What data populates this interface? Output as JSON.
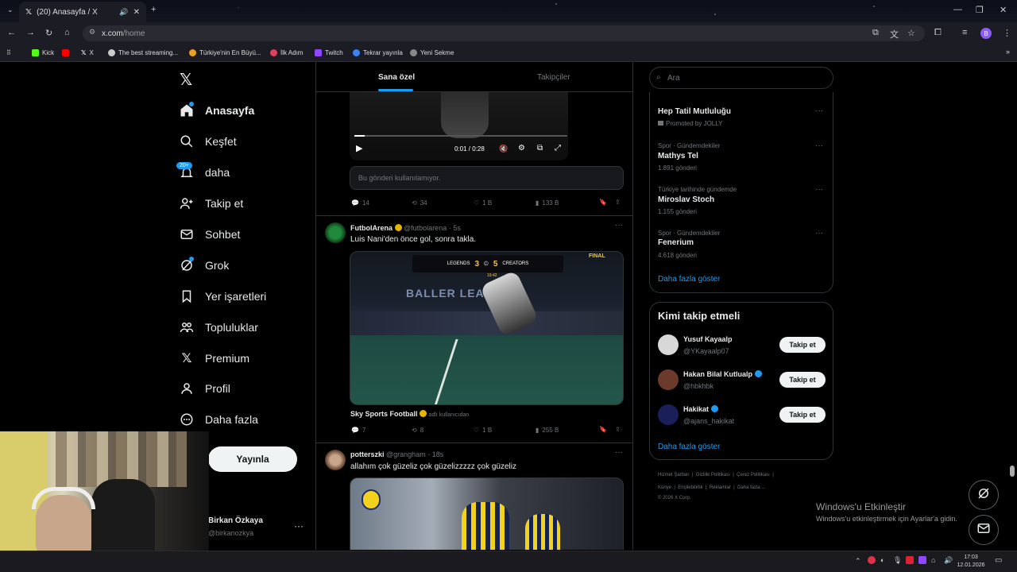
{
  "browser": {
    "tab_title": "(20) Anasayfa / X",
    "url_prefix": "x.com",
    "url_path": "/home",
    "profile_initial": "B",
    "bookmarks": [
      {
        "label": "Kick",
        "color": "#53fc18"
      },
      {
        "label": "",
        "color": "#ff0000"
      },
      {
        "label": "X",
        "color": "#ffffff"
      },
      {
        "label": "The best streaming...",
        "color": "#cccccc"
      },
      {
        "label": "Türkiye'nin En Büyü...",
        "color": "#f0a020"
      },
      {
        "label": "İlk Adım",
        "color": "#e04060"
      },
      {
        "label": "Twitch",
        "color": "#9146ff"
      },
      {
        "label": "Tekrar yayınla",
        "color": "#3b82f6"
      },
      {
        "label": "Yeni Sekme",
        "color": "#888888"
      }
    ]
  },
  "nav": {
    "items": [
      {
        "label": "Anasayfa",
        "icon": "home-icon"
      },
      {
        "label": "Keşfet",
        "icon": "search-icon"
      },
      {
        "label": "daha",
        "icon": "bell-icon",
        "badge": "20+"
      },
      {
        "label": "Takip et",
        "icon": "add-user-icon"
      },
      {
        "label": "Sohbet",
        "icon": "mail-icon"
      },
      {
        "label": "Grok",
        "icon": "grok-icon"
      },
      {
        "label": "Yer işaretleri",
        "icon": "bookmark-icon"
      },
      {
        "label": "Topluluklar",
        "icon": "communities-icon"
      },
      {
        "label": "Premium",
        "icon": "x-logo-icon"
      },
      {
        "label": "Profil",
        "icon": "person-icon"
      },
      {
        "label": "Daha fazla",
        "icon": "more-circle-icon"
      }
    ],
    "post_button": "Yayınla",
    "account_name": "Birkan Özkaya",
    "account_handle": "@birkanozkya"
  },
  "main": {
    "tabs": [
      "Sana özel",
      "Takipçiler"
    ],
    "post1": {
      "video_time": "0:01 / 0:28",
      "unavailable_note": "Bu gönderi kullanılamıyor.",
      "stats": {
        "replies": "14",
        "reposts": "34",
        "likes": "1 B",
        "views": "133 B"
      }
    },
    "post2": {
      "name": "FutbolArena",
      "handle": "@futbolarena",
      "time": "· 5s",
      "text": "Luis Nani'den önce gol, sonra takla.",
      "scoreboard": {
        "left": "LEGENDS",
        "score_left": "3",
        "score_right": "5",
        "right": "CREATORS",
        "clock": "19:42",
        "corner": "FINAL"
      },
      "banner": "BALLER LEAGUE",
      "source_name": "Sky Sports Football",
      "source_note": "adlı kullanıcıdan",
      "stats": {
        "replies": "7",
        "reposts": "8",
        "likes": "1 B",
        "views": "255 B"
      }
    },
    "post3": {
      "name": "potterszki",
      "handle": "@grangham",
      "time": "· 18s",
      "text": "allahım çok güzeliz çok güzelizzzzz çok güzeliz"
    }
  },
  "right": {
    "search_placeholder": "Ara",
    "trends": [
      {
        "meta": "Promoted by JOLLY",
        "title": "Hep Tatil Mutluluğu",
        "count": ""
      },
      {
        "meta": "Spor · Gündemdekiler",
        "title": "Mathys Tel",
        "count": "1.891 gönderi"
      },
      {
        "meta": "Türkiye tarihinde gündemde",
        "title": "Miroslav Stoch",
        "count": "1.155 gönderi"
      },
      {
        "meta": "Spor · Gündemdekiler",
        "title": "Fenerium",
        "count": "4.618 gönderi"
      }
    ],
    "show_more": "Daha fazla göster",
    "who_to_follow_title": "Kimi takip etmeli",
    "suggestions": [
      {
        "name": "Yusuf Kayaalp",
        "handle": "@YKayaalp07",
        "verified": false,
        "avatar_color": "#d8d8d8"
      },
      {
        "name": "Hakan Bilal Kutlualp",
        "handle": "@hbkhbk",
        "verified": true,
        "avatar_color": "#6b3a2a"
      },
      {
        "name": "Hakikat",
        "handle": "@ajans_hakikat",
        "verified": true,
        "avatar_color": "#1a1f5a"
      }
    ],
    "follow_label": "Takip et",
    "footer_row1": [
      "Hizmet Şartları",
      "Gizlilik Politikası",
      "Çerez Politikası"
    ],
    "footer_row2": [
      "Künye",
      "Erişilebilirlik",
      "Reklamlar",
      "Daha fazla ..."
    ],
    "copyright": "© 2026 X Corp."
  },
  "windows": {
    "activate_title": "Windows'u Etkinleştir",
    "activate_sub": "Windows'u etkinleştirmek için Ayarlar'a gidin.",
    "clock_time": "17:03",
    "clock_date": "12.01.2026"
  },
  "colors": {
    "accent": "#1d9bf0",
    "verified": "#1d9bf0",
    "gold_verified": "#e8b600"
  }
}
